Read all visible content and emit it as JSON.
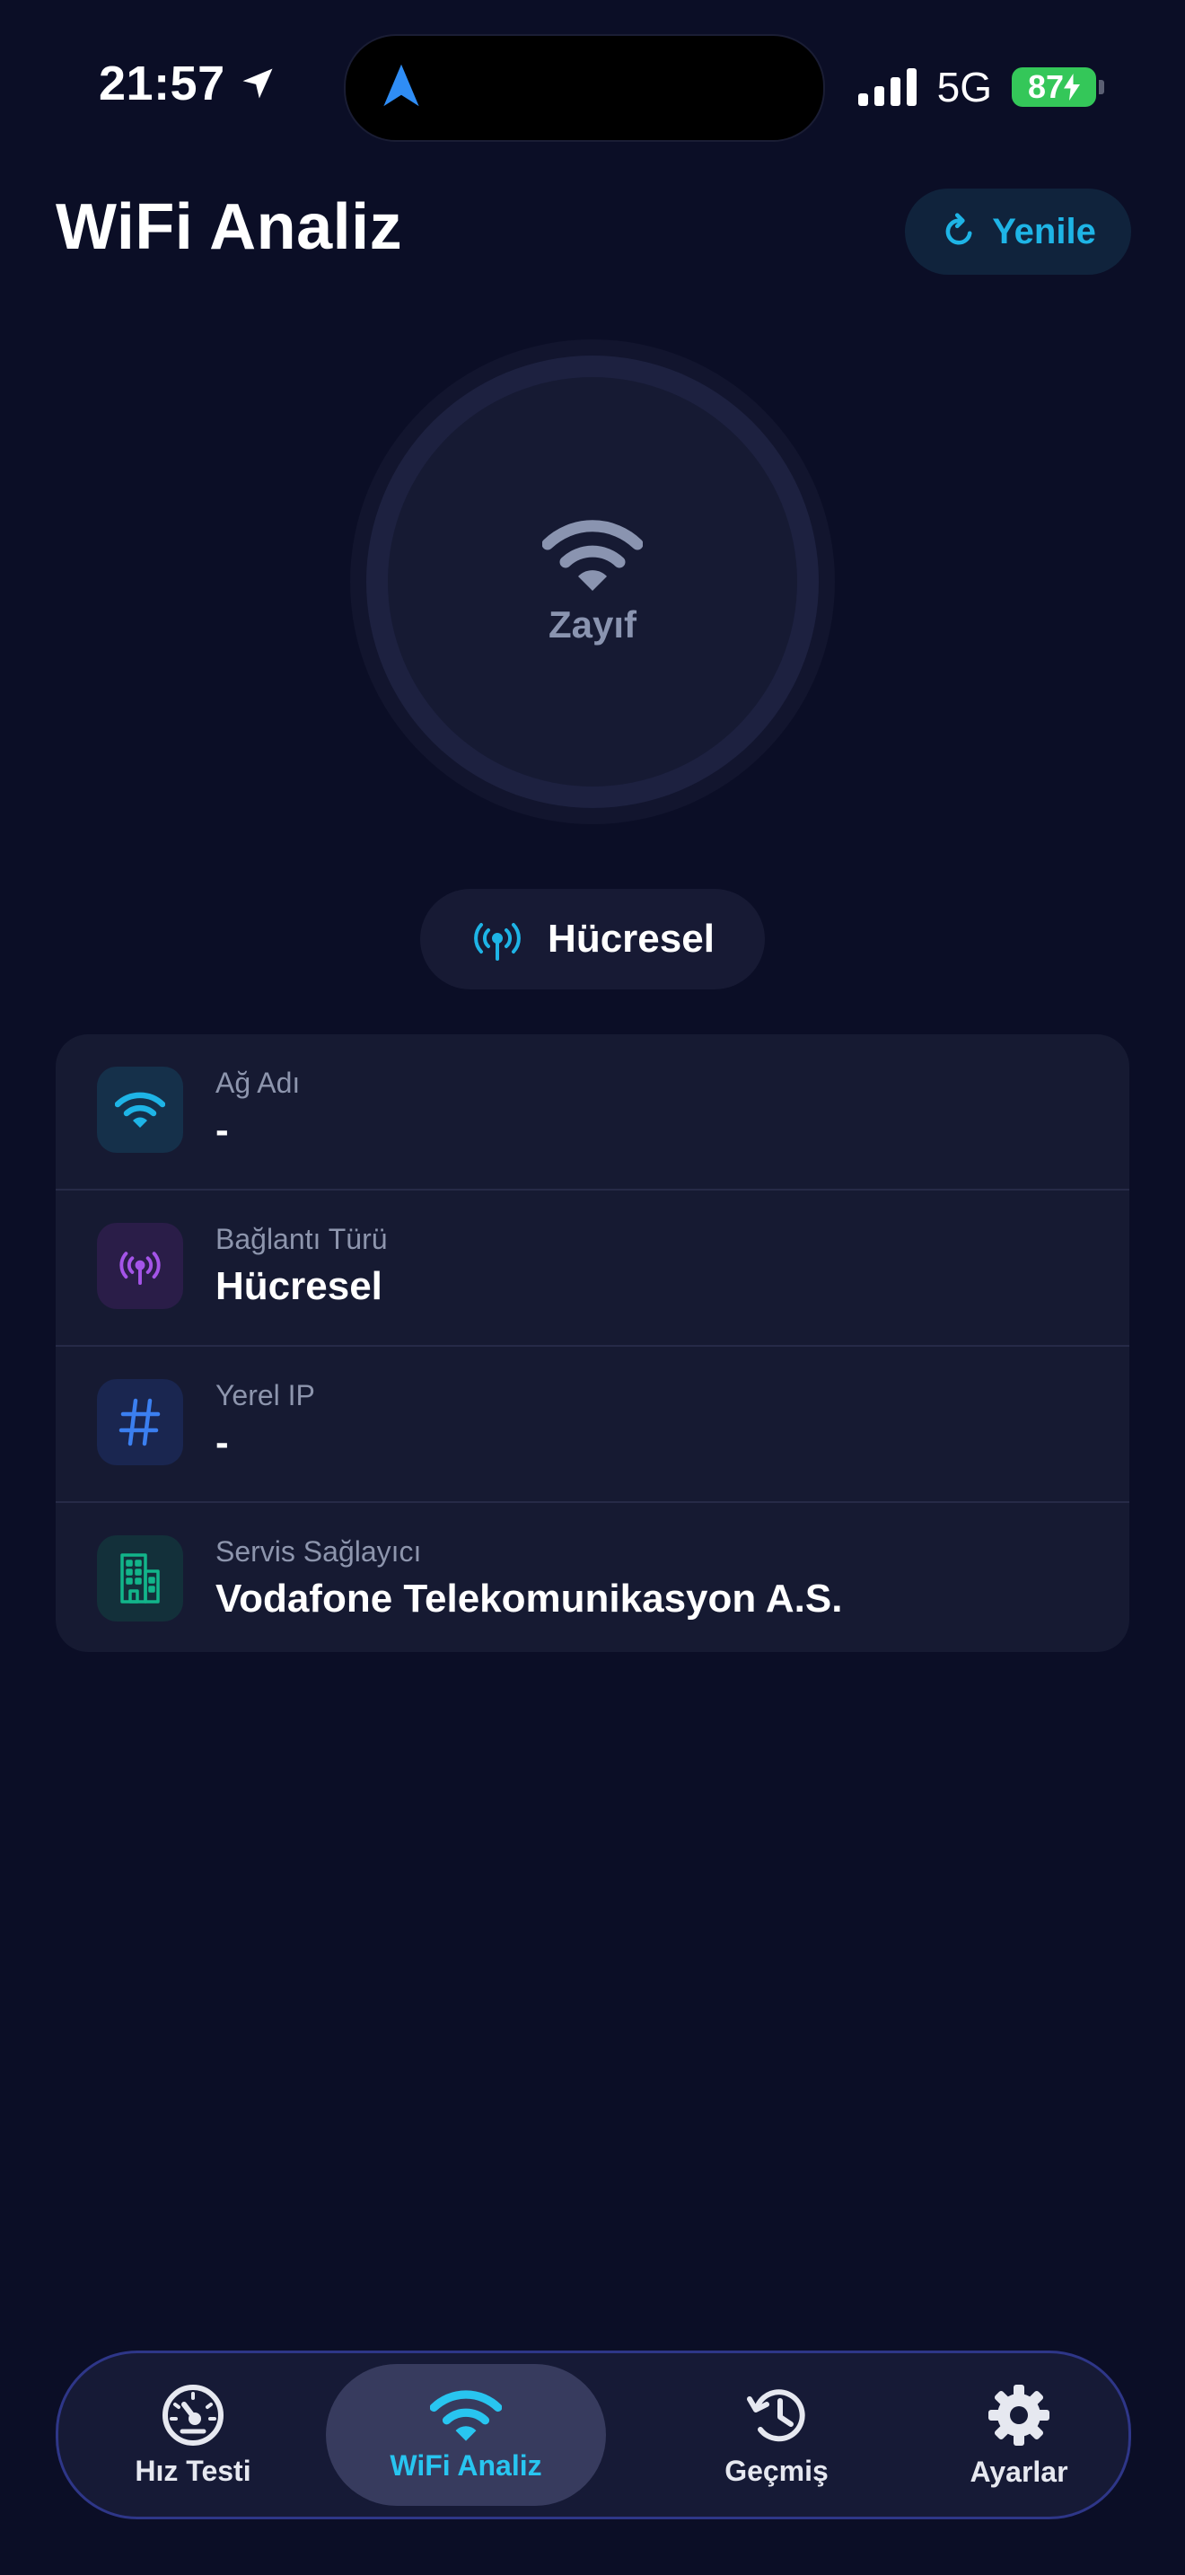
{
  "status_bar": {
    "time": "21:57",
    "network": "5G",
    "battery": "87"
  },
  "header": {
    "title": "WiFi Analiz",
    "refresh_label": "Yenile"
  },
  "signal": {
    "strength_label": "Zayıf"
  },
  "connection": {
    "type_label": "Hücresel"
  },
  "info": {
    "rows": [
      {
        "label": "Ağ Adı",
        "value": "-",
        "icon": "wifi-icon",
        "color": "#1eb4e6"
      },
      {
        "label": "Bağlantı Türü",
        "value": "Hücresel",
        "icon": "antenna-icon",
        "color": "#a454e8"
      },
      {
        "label": "Yerel IP",
        "value": "-",
        "icon": "hash-icon",
        "color": "#3b7ff0"
      },
      {
        "label": "Servis Sağlayıcı",
        "value": "Vodafone Telekomunikasyon A.S.",
        "icon": "building-icon",
        "color": "#12b58a"
      }
    ]
  },
  "tabs": [
    {
      "label": "Hız Testi",
      "icon": "speedometer-icon",
      "active": false
    },
    {
      "label": "WiFi Analiz",
      "icon": "wifi-icon",
      "active": true
    },
    {
      "label": "Geçmiş",
      "icon": "history-icon",
      "active": false
    },
    {
      "label": "Ayarlar",
      "icon": "gear-icon",
      "active": false
    }
  ],
  "colors": {
    "background": "#0b0e26",
    "accent": "#28c5f0",
    "battery": "#34c759"
  }
}
